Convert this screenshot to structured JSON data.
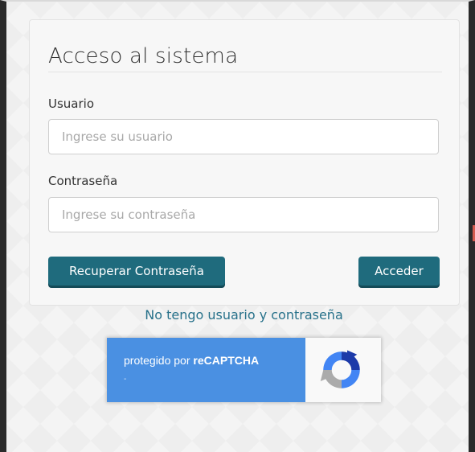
{
  "login": {
    "title": "Acceso al sistema",
    "username_label": "Usuario",
    "username_placeholder": "Ingrese su usuario",
    "password_label": "Contraseña",
    "password_placeholder": "Ingrese su contraseña",
    "recover_button": "Recuperar Contraseña",
    "login_button": "Acceder",
    "no_account_link": "No tengo usuario y contraseña"
  },
  "recaptcha": {
    "prefix": "protegido por ",
    "brand": "reCAPTCHA",
    "subtext": "-",
    "icon": "recaptcha-logo-icon"
  },
  "colors": {
    "button": "#1f6b7d",
    "link": "#27718a",
    "recaptcha_blue": "#4a90e2"
  }
}
